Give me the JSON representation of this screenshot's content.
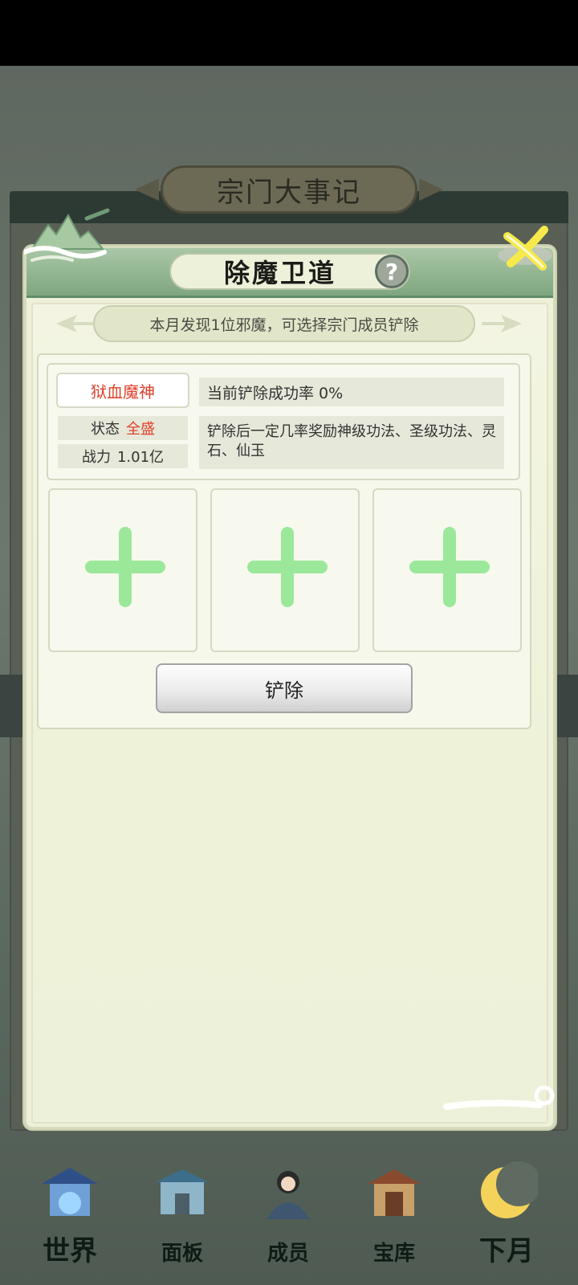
{
  "background": {
    "panel_title": "宗门大事记"
  },
  "dialog": {
    "title": "除魔卫道",
    "help_symbol": "?",
    "banner": "本月发现1位邪魔，可选择宗门成员铲除",
    "demon": {
      "name": "狱血魔神",
      "status_label": "状态",
      "status_value": "全盛",
      "power_label": "战力",
      "power_value": "1.01亿"
    },
    "success_rate": "当前铲除成功率 0%",
    "reward_text": "铲除后一定几率奖励神级功法、圣级功法、灵石、仙玉",
    "member_slots": [
      "add",
      "add",
      "add"
    ],
    "remove_button": "铲除"
  },
  "bottom_nav": {
    "items": [
      {
        "label": "世界",
        "icon": "palace-icon"
      },
      {
        "label": "面板",
        "icon": "gate-icon"
      },
      {
        "label": "成员",
        "icon": "member-icon"
      },
      {
        "label": "宝库",
        "icon": "treasury-icon"
      },
      {
        "label": "下月",
        "icon": "moon-icon"
      }
    ]
  },
  "colors": {
    "header_green": "#7fa67f",
    "dialog_bg": "#eef0d8",
    "accent_red": "#e0402a",
    "plus_green": "#9be89b"
  }
}
